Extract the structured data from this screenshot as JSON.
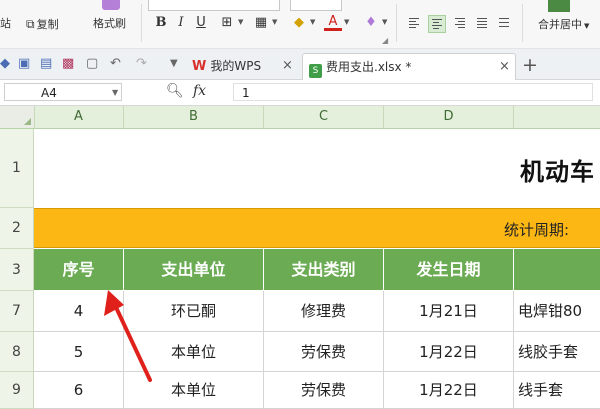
{
  "ribbon": {
    "paste_label": "站",
    "copy_label": "复制",
    "format_painter_label": "格式刷",
    "bold": "B",
    "italic": "I",
    "underline": "U",
    "font_color_letter": "A",
    "merge_center_label": "合并居中"
  },
  "tabs": {
    "wps_label": "我的WPS",
    "file_label": "费用支出.xlsx *",
    "close_glyph": "×",
    "new_tab_glyph": "+"
  },
  "formula_bar": {
    "cell_ref": "A4",
    "fx": "fx",
    "value": "1"
  },
  "columns": [
    "A",
    "B",
    "C",
    "D"
  ],
  "rows": [
    "1",
    "2",
    "3",
    "7",
    "8",
    "9"
  ],
  "sheet": {
    "title": "机动车",
    "period_label": "统计周期:",
    "headers": [
      "序号",
      "支出单位",
      "支出类别",
      "发生日期"
    ],
    "data_rows": [
      {
        "no": "4",
        "unit": "环已酮",
        "category": "修理费",
        "date": "1月21日",
        "item": "电焊钳80"
      },
      {
        "no": "5",
        "unit": "本单位",
        "category": "劳保费",
        "date": "1月22日",
        "item": "线胶手套"
      },
      {
        "no": "6",
        "unit": "本单位",
        "category": "劳保费",
        "date": "1月22日",
        "item": "线手套"
      }
    ]
  },
  "colors": {
    "header_green": "#6bab54",
    "period_orange": "#fcb715",
    "arrow_red": "#e0211b"
  }
}
